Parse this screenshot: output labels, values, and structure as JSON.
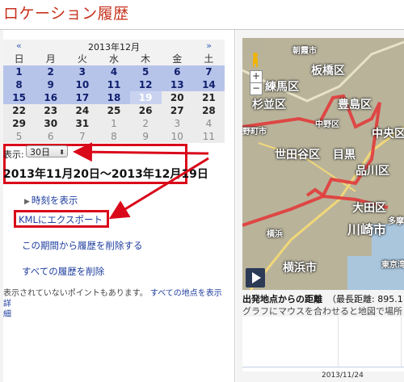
{
  "page": {
    "title": "ロケーション履歴"
  },
  "calendar": {
    "prev": "«",
    "next": "»",
    "month": "2013年12月",
    "weekdays": [
      "日",
      "月",
      "火",
      "水",
      "木",
      "金",
      "土"
    ],
    "weeks": [
      [
        {
          "d": "1",
          "s": "sel"
        },
        {
          "d": "2",
          "s": "sel"
        },
        {
          "d": "3",
          "s": "sel"
        },
        {
          "d": "4",
          "s": "sel"
        },
        {
          "d": "5",
          "s": "sel"
        },
        {
          "d": "6",
          "s": "sel"
        },
        {
          "d": "7",
          "s": "sel"
        }
      ],
      [
        {
          "d": "8",
          "s": "sel"
        },
        {
          "d": "9",
          "s": "sel"
        },
        {
          "d": "10",
          "s": "sel"
        },
        {
          "d": "11",
          "s": "sel"
        },
        {
          "d": "12",
          "s": "sel"
        },
        {
          "d": "13",
          "s": "sel"
        },
        {
          "d": "14",
          "s": "sel"
        }
      ],
      [
        {
          "d": "15",
          "s": "sel"
        },
        {
          "d": "16",
          "s": "sel"
        },
        {
          "d": "17",
          "s": "sel"
        },
        {
          "d": "18",
          "s": "sel"
        },
        {
          "d": "19",
          "s": "today"
        },
        {
          "d": "20",
          "s": "plain"
        },
        {
          "d": "21",
          "s": "plain"
        }
      ],
      [
        {
          "d": "22",
          "s": "plain"
        },
        {
          "d": "23",
          "s": "plain"
        },
        {
          "d": "24",
          "s": "plain"
        },
        {
          "d": "25",
          "s": "plain"
        },
        {
          "d": "26",
          "s": "plain"
        },
        {
          "d": "27",
          "s": "plain"
        },
        {
          "d": "28",
          "s": "plain"
        }
      ],
      [
        {
          "d": "29",
          "s": "plain"
        },
        {
          "d": "30",
          "s": "plain"
        },
        {
          "d": "31",
          "s": "plain"
        },
        {
          "d": "1",
          "s": "grey"
        },
        {
          "d": "2",
          "s": "grey"
        },
        {
          "d": "3",
          "s": "grey"
        },
        {
          "d": "4",
          "s": "grey"
        }
      ],
      [
        {
          "d": "5",
          "s": "grey"
        },
        {
          "d": "6",
          "s": "grey"
        },
        {
          "d": "7",
          "s": "grey"
        },
        {
          "d": "8",
          "s": "grey"
        },
        {
          "d": "9",
          "s": "grey"
        },
        {
          "d": "10",
          "s": "grey"
        },
        {
          "d": "11",
          "s": "grey"
        }
      ]
    ]
  },
  "range": {
    "show_label": "表示:",
    "select_value": "30日",
    "text": "2013年11月20日〜2013年12月19日"
  },
  "links": {
    "show_time": "時刻を表示",
    "kml_export": "KMLにエクスポート",
    "delete_period": "この期間から履歴を削除する",
    "delete_all": "すべての履歴を削除"
  },
  "note": {
    "text": "表示されていないポイントもあります。",
    "show_all": "すべての地点を表示",
    "detail_a": "詳",
    "detail_b": "細"
  },
  "map": {
    "labels": [
      "朝霞市",
      "板橋区",
      "練馬区",
      "豊島区",
      "杉並区",
      "中野区",
      "野町市",
      "世田谷区",
      "中央区",
      "目黒",
      "品川区",
      "大田区",
      "多摩",
      "川崎市",
      "横浜",
      "横浜市",
      "東京湾"
    ],
    "zoom_in": "+",
    "zoom_out": "−"
  },
  "distance": {
    "title": "出発地点からの距離",
    "max": "（最長距離: 895.1",
    "hint": "グラフにマウスを合わせると地図で場所",
    "date": "2013/11/24"
  },
  "colors": {
    "accent_red": "#d9091a",
    "title_red": "#c8321e",
    "link_blue": "#1f3e9e",
    "selected": "#b7c4ea"
  }
}
